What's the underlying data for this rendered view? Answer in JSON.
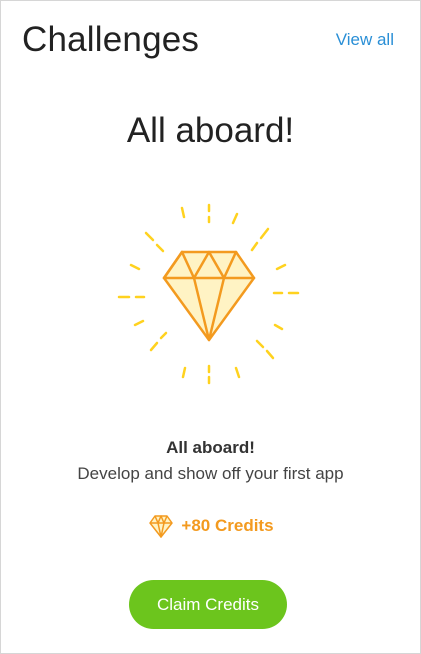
{
  "header": {
    "title": "Challenges",
    "view_all_label": "View all"
  },
  "challenge": {
    "heading": "All aboard!",
    "hero_icon": "diamond-icon",
    "name": "All aboard!",
    "description": "Develop and show off your first app",
    "reward_icon": "diamond-icon",
    "reward_text": "+80 Credits",
    "claim_label": "Claim Credits"
  },
  "colors": {
    "accent_link": "#2a8fd6",
    "diamond_stroke": "#f39a1f",
    "diamond_fill": "#fff3c4",
    "rays": "#ffd21f",
    "reward_text": "#f39a1f",
    "button": "#6cc51d"
  }
}
